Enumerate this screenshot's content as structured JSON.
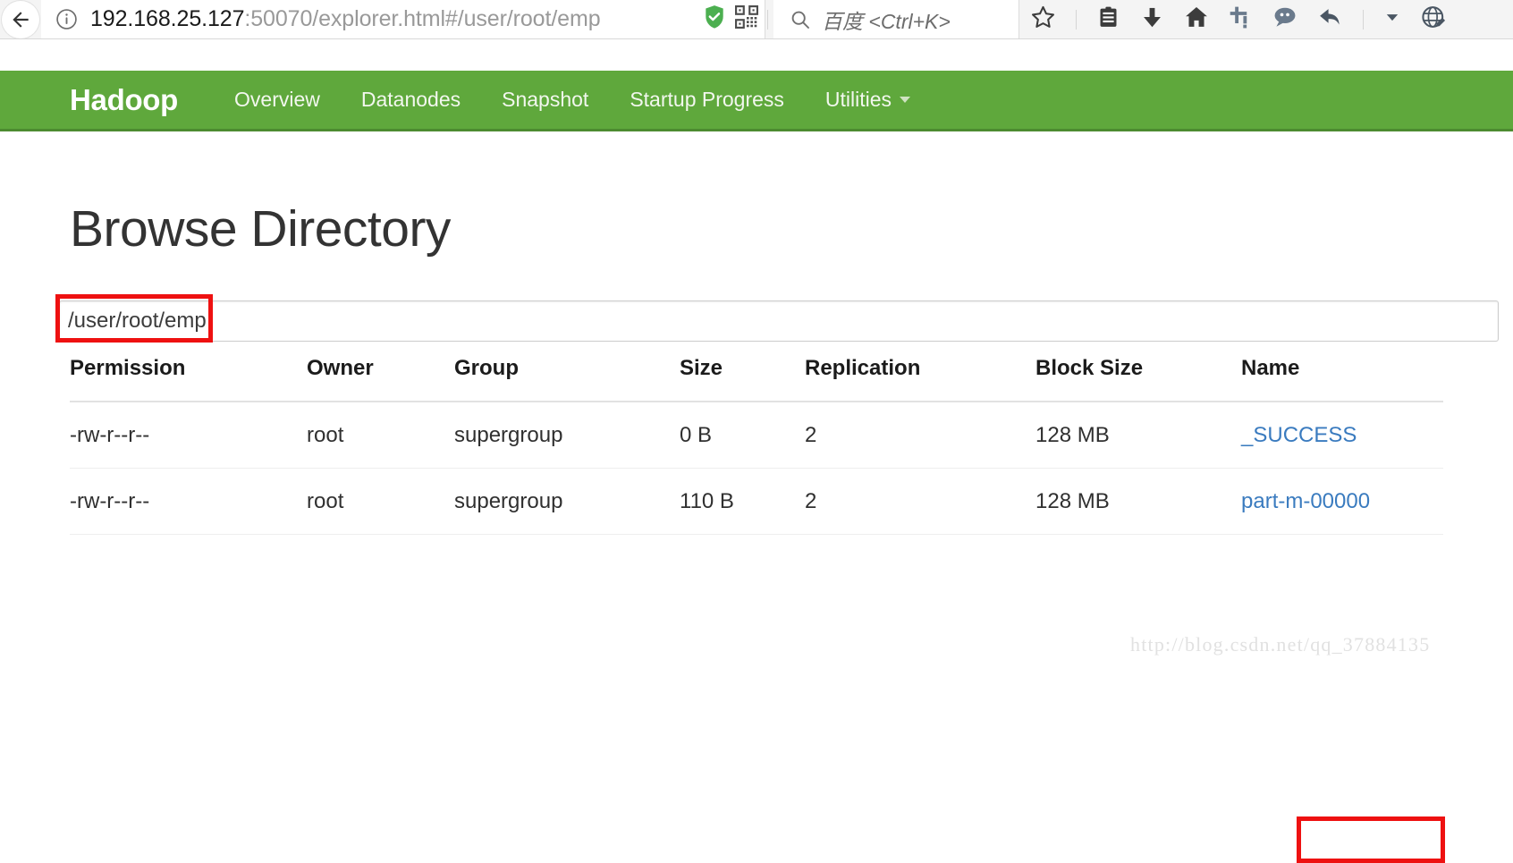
{
  "browser": {
    "back_icon": "back-arrow-icon",
    "info_icon": "info-icon",
    "url_host": "192.168.25.127",
    "url_rest": ":50070/explorer.html#/user/root/emp",
    "shield_icon": "security-shield-icon",
    "qrcode_icon": "qrcode-icon",
    "reload_icon": "reload-icon",
    "search_icon": "search-icon",
    "search_placeholder": "百度 <Ctrl+K>",
    "toolbar_icons": [
      "star-bookmark-icon",
      "clipboard-list-icon",
      "download-icon",
      "home-icon",
      "crop-screenshot-icon",
      "speech-bubble-icon",
      "undo-back-icon",
      "chevron-down-icon",
      "globe-edit-icon"
    ]
  },
  "navbar": {
    "brand": "Hadoop",
    "items": [
      {
        "label": "Overview",
        "caret": false
      },
      {
        "label": "Datanodes",
        "caret": false
      },
      {
        "label": "Snapshot",
        "caret": false
      },
      {
        "label": "Startup Progress",
        "caret": false
      },
      {
        "label": "Utilities",
        "caret": true
      }
    ],
    "background_color": "#5fa83c"
  },
  "page": {
    "title": "Browse Directory",
    "path_value": "/user/root/emp",
    "watermark": "http://blog.csdn.net/qq_37884135",
    "annotation_color": "#ee1111",
    "link_color": "#3a7bbf"
  },
  "table": {
    "headers": [
      "Permission",
      "Owner",
      "Group",
      "Size",
      "Replication",
      "Block Size",
      "Name"
    ],
    "rows": [
      {
        "permission": "-rw-r--r--",
        "owner": "root",
        "group": "supergroup",
        "size": "0 B",
        "replication": "2",
        "block_size": "128 MB",
        "name": "_SUCCESS"
      },
      {
        "permission": "-rw-r--r--",
        "owner": "root",
        "group": "supergroup",
        "size": "110 B",
        "replication": "2",
        "block_size": "128 MB",
        "name": "part-m-00000"
      }
    ]
  }
}
